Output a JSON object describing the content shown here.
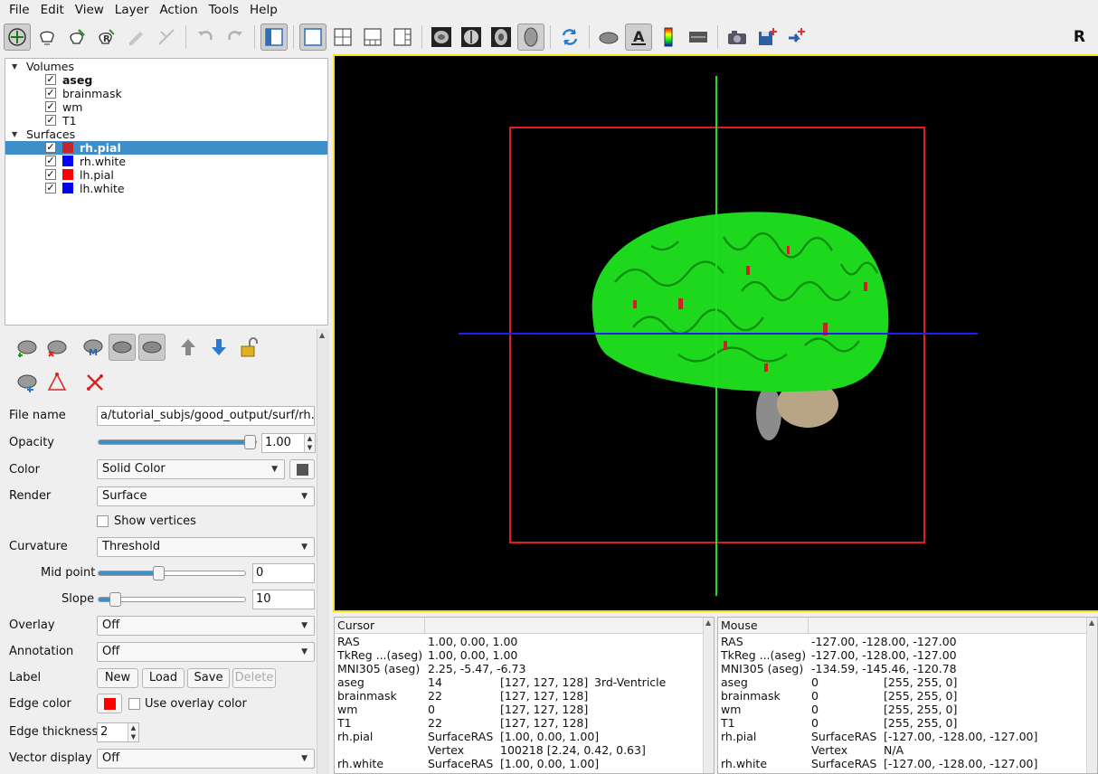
{
  "menu": [
    "File",
    "Edit",
    "View",
    "Layer",
    "Action",
    "Tools",
    "Help"
  ],
  "toolbar": {
    "orientation": "R"
  },
  "layers": {
    "volumes_label": "Volumes",
    "volumes": [
      {
        "name": "aseg",
        "bold": true
      },
      {
        "name": "brainmask"
      },
      {
        "name": "wm"
      },
      {
        "name": "T1"
      }
    ],
    "surfaces_label": "Surfaces",
    "surfaces": [
      {
        "name": "rh.pial",
        "color": "#c4262e",
        "selected": true
      },
      {
        "name": "rh.white",
        "color": "#0000ff"
      },
      {
        "name": "lh.pial",
        "color": "#ff0000"
      },
      {
        "name": "lh.white",
        "color": "#0000ee"
      }
    ]
  },
  "panel": {
    "file_name_label": "File name",
    "file_name_value": "a/tutorial_subjs/good_output/surf/rh.pial",
    "opacity_label": "Opacity",
    "opacity_value": "1.00",
    "opacity_level": 1.0,
    "color_label": "Color",
    "color_value": "Solid Color",
    "color_swatch": "#555555",
    "render_label": "Render",
    "render_value": "Surface",
    "show_vertices_label": "Show vertices",
    "curvature_label": "Curvature",
    "curvature_value": "Threshold",
    "midpoint_label": "Mid point",
    "midpoint_value": "0",
    "midpoint_level": 0.4,
    "slope_label": "Slope",
    "slope_value": "10",
    "slope_level": 0.08,
    "overlay_label": "Overlay",
    "overlay_value": "Off",
    "annotation_label": "Annotation",
    "annotation_value": "Off",
    "label_label": "Label",
    "label_new": "New",
    "label_load": "Load",
    "label_save": "Save",
    "label_delete": "Delete",
    "edge_color_label": "Edge color",
    "edge_color": "#ff0000",
    "use_overlay_color_label": "Use overlay color",
    "edge_thickness_label": "Edge thickness",
    "edge_thickness_value": "2",
    "vector_display_label": "Vector display",
    "vector_display_value": "Off"
  },
  "cursor_info": {
    "title": "Cursor",
    "rows": [
      [
        "RAS",
        "1.00, 0.00, 1.00",
        "",
        ""
      ],
      [
        "TkReg ...(aseg)",
        "1.00, 0.00, 1.00",
        "",
        ""
      ],
      [
        "MNI305 (aseg)",
        "2.25, -5.47, -6.73",
        "",
        ""
      ],
      [
        "aseg",
        "14",
        "[127, 127, 128]",
        "3rd-Ventricle"
      ],
      [
        "brainmask",
        "22",
        "[127, 127, 128]",
        ""
      ],
      [
        "wm",
        "0",
        "[127, 127, 128]",
        ""
      ],
      [
        "T1",
        "22",
        "[127, 127, 128]",
        ""
      ],
      [
        "rh.pial",
        "SurfaceRAS",
        "[1.00, 0.00, 1.00]",
        ""
      ],
      [
        "",
        "Vertex",
        "100218  [2.24, 0.42, 0.63]",
        ""
      ],
      [
        "rh.white",
        "SurfaceRAS",
        "[1.00, 0.00, 1.00]",
        ""
      ]
    ]
  },
  "mouse_info": {
    "title": "Mouse",
    "rows": [
      [
        "RAS",
        "-127.00, -128.00, -127.00",
        ""
      ],
      [
        "TkReg ...(aseg)",
        "-127.00, -128.00, -127.00",
        ""
      ],
      [
        "MNI305 (aseg)",
        "-134.59, -145.46, -120.78",
        ""
      ],
      [
        "aseg",
        "0",
        "[255, 255, 0]"
      ],
      [
        "brainmask",
        "0",
        "[255, 255, 0]"
      ],
      [
        "wm",
        "0",
        "[255, 255, 0]"
      ],
      [
        "T1",
        "0",
        "[255, 255, 0]"
      ],
      [
        "rh.pial",
        "SurfaceRAS",
        "[-127.00, -128.00, -127.00]"
      ],
      [
        "",
        "Vertex",
        "N/A"
      ],
      [
        "rh.white",
        "SurfaceRAS",
        "[-127.00, -128.00, -127.00]"
      ]
    ]
  }
}
